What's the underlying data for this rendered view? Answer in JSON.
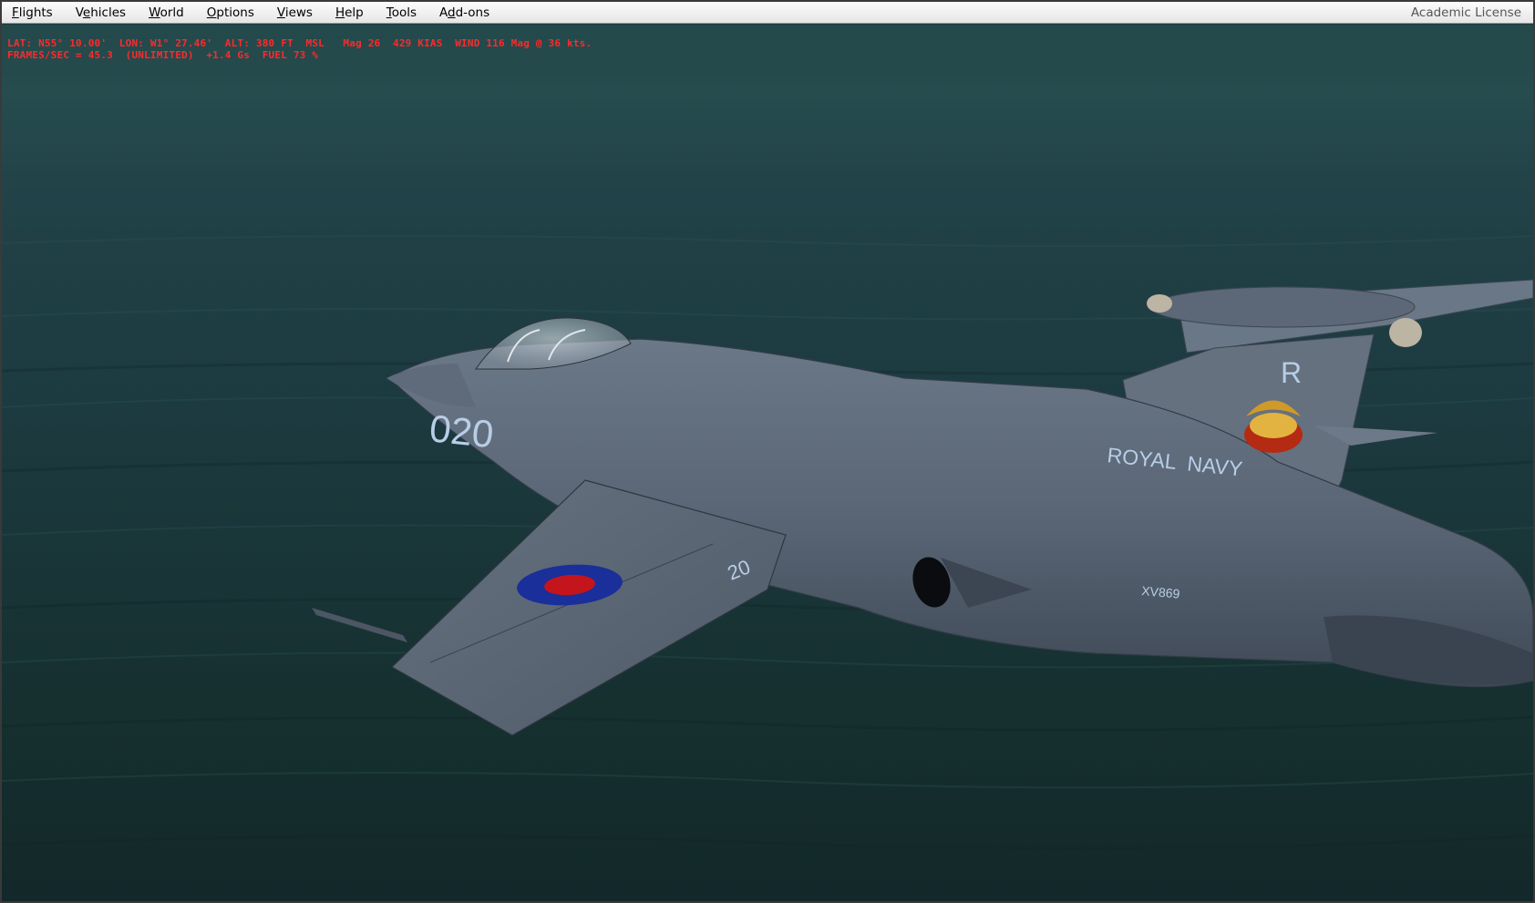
{
  "menu": {
    "items": [
      {
        "mnemonic": "F",
        "rest": "lights"
      },
      {
        "pre": "V",
        "mnemonic": "e",
        "rest": "hicles"
      },
      {
        "mnemonic": "W",
        "rest": "orld"
      },
      {
        "mnemonic": "O",
        "rest": "ptions"
      },
      {
        "mnemonic": "V",
        "rest": "iews"
      },
      {
        "mnemonic": "H",
        "rest": "elp"
      },
      {
        "mnemonic": "T",
        "rest": "ools"
      },
      {
        "pre": "A",
        "mnemonic": "d",
        "rest": "d-ons"
      }
    ],
    "license_text": "Academic License"
  },
  "hud": {
    "line1": "LAT: N55° 10.00'  LON: W1° 27.46'  ALT: 380 FT  MSL   Mag 26  429 KIAS  WIND 116 Mag @ 36 kts.",
    "line2": "FRAMES/SEC = 45.3  (UNLIMITED)  +1.4 Gs  FUEL 73 %",
    "color": "#ff2a2a"
  },
  "aircraft_markings": {
    "nose_number": "020",
    "wing_number": "20",
    "tail_letter": "R",
    "fuselage_text": "ROYAL  NAVY",
    "serial": "XV869"
  },
  "colors": {
    "sea": "#1c3a40",
    "aircraft_grey": "#5a6778",
    "roundel_outer": "#1a2f9a",
    "roundel_inner": "#c4151c",
    "marking_light_blue": "#b8cde6"
  }
}
